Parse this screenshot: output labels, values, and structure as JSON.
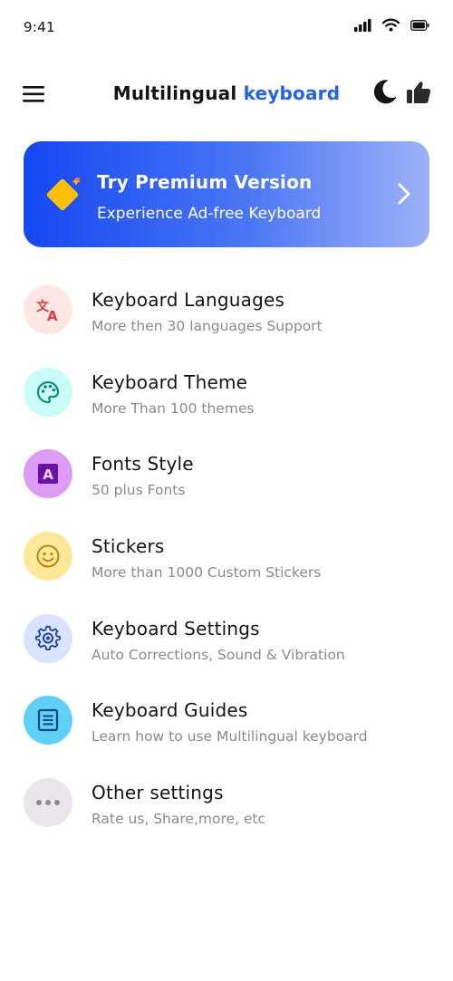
{
  "status_bar": {
    "time": "9:41",
    "icons": [
      "cellular-signal-icon",
      "wifi-icon",
      "battery-icon"
    ]
  },
  "header": {
    "title_main": "Multilingual",
    "title_accent": "keyboard",
    "accent_color": "#2463e8",
    "icons": [
      "hamburger-menu-icon",
      "moon-icon",
      "thumbs-up-icon"
    ]
  },
  "premium": {
    "title": "Try Premium Version",
    "subtitle": "Experience Ad-free Keyboard",
    "gradient_start": "#1547f2",
    "gradient_end": "#9db1f7",
    "icon": "diamond-icon"
  },
  "menu": {
    "items": [
      {
        "title": "Keyboard Languages",
        "subtitle": "More then 30 languages Support",
        "icon": "translate-icon",
        "bg": "#fde6e4",
        "fg": "#e53935"
      },
      {
        "title": "Keyboard Theme",
        "subtitle": "More Than 100 themes",
        "icon": "palette-icon",
        "bg": "#c9fbf7",
        "fg": "#0f8a7e"
      },
      {
        "title": "Fonts Style",
        "subtitle": "50 plus Fonts",
        "icon": "font-icon",
        "bg": "#dc9cf4",
        "fg": "#6a12a6"
      },
      {
        "title": "Stickers",
        "subtitle": "More than 1000 Custom Stickers",
        "icon": "smiley-icon",
        "bg": "#fde89a",
        "fg": "#b8860b"
      },
      {
        "title": "Keyboard Settings",
        "subtitle": "Auto Corrections, Sound & Vibration",
        "icon": "gear-icon",
        "bg": "#d9e2ff",
        "fg": "#1a3fa8"
      },
      {
        "title": "Keyboard Guides",
        "subtitle": "Learn how to use Multilingual keyboard",
        "icon": "document-icon",
        "bg": "#5fd0f7",
        "fg": "#0d4a7a"
      },
      {
        "title": "Other settings",
        "subtitle": "Rate us, Share,more, etc",
        "icon": "more-dots-icon",
        "bg": "#e8e6ea",
        "fg": "#8e8b92"
      }
    ]
  }
}
